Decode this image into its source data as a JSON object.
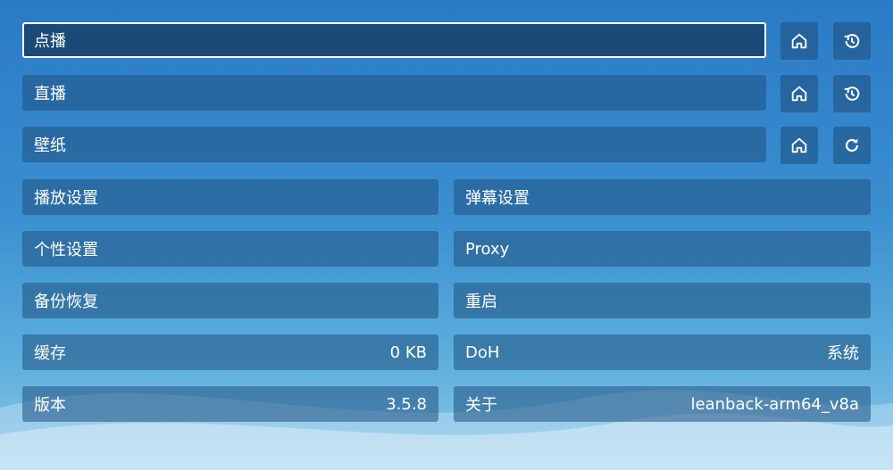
{
  "sources": [
    {
      "label": "点播",
      "icons": [
        "home-icon",
        "history-icon"
      ]
    },
    {
      "label": "直播",
      "icons": [
        "home-icon",
        "history-icon"
      ]
    },
    {
      "label": "壁纸",
      "icons": [
        "home-icon",
        "refresh-icon"
      ]
    }
  ],
  "settings": {
    "playback": "播放设置",
    "danmaku": "弹幕设置",
    "personal": "个性设置",
    "proxy": "Proxy",
    "backup": "备份恢复",
    "restart": "重启",
    "cache_label": "缓存",
    "cache_value": "0 KB",
    "doh_label": "DoH",
    "doh_value": "系统",
    "version_label": "版本",
    "version_value": "3.5.8",
    "about_label": "关于",
    "about_value": "leanback-arm64_v8a"
  },
  "colors": {
    "accent": "#1b4a78",
    "background_top": "#2a7ac6",
    "background_bottom": "#8cc8ea"
  }
}
